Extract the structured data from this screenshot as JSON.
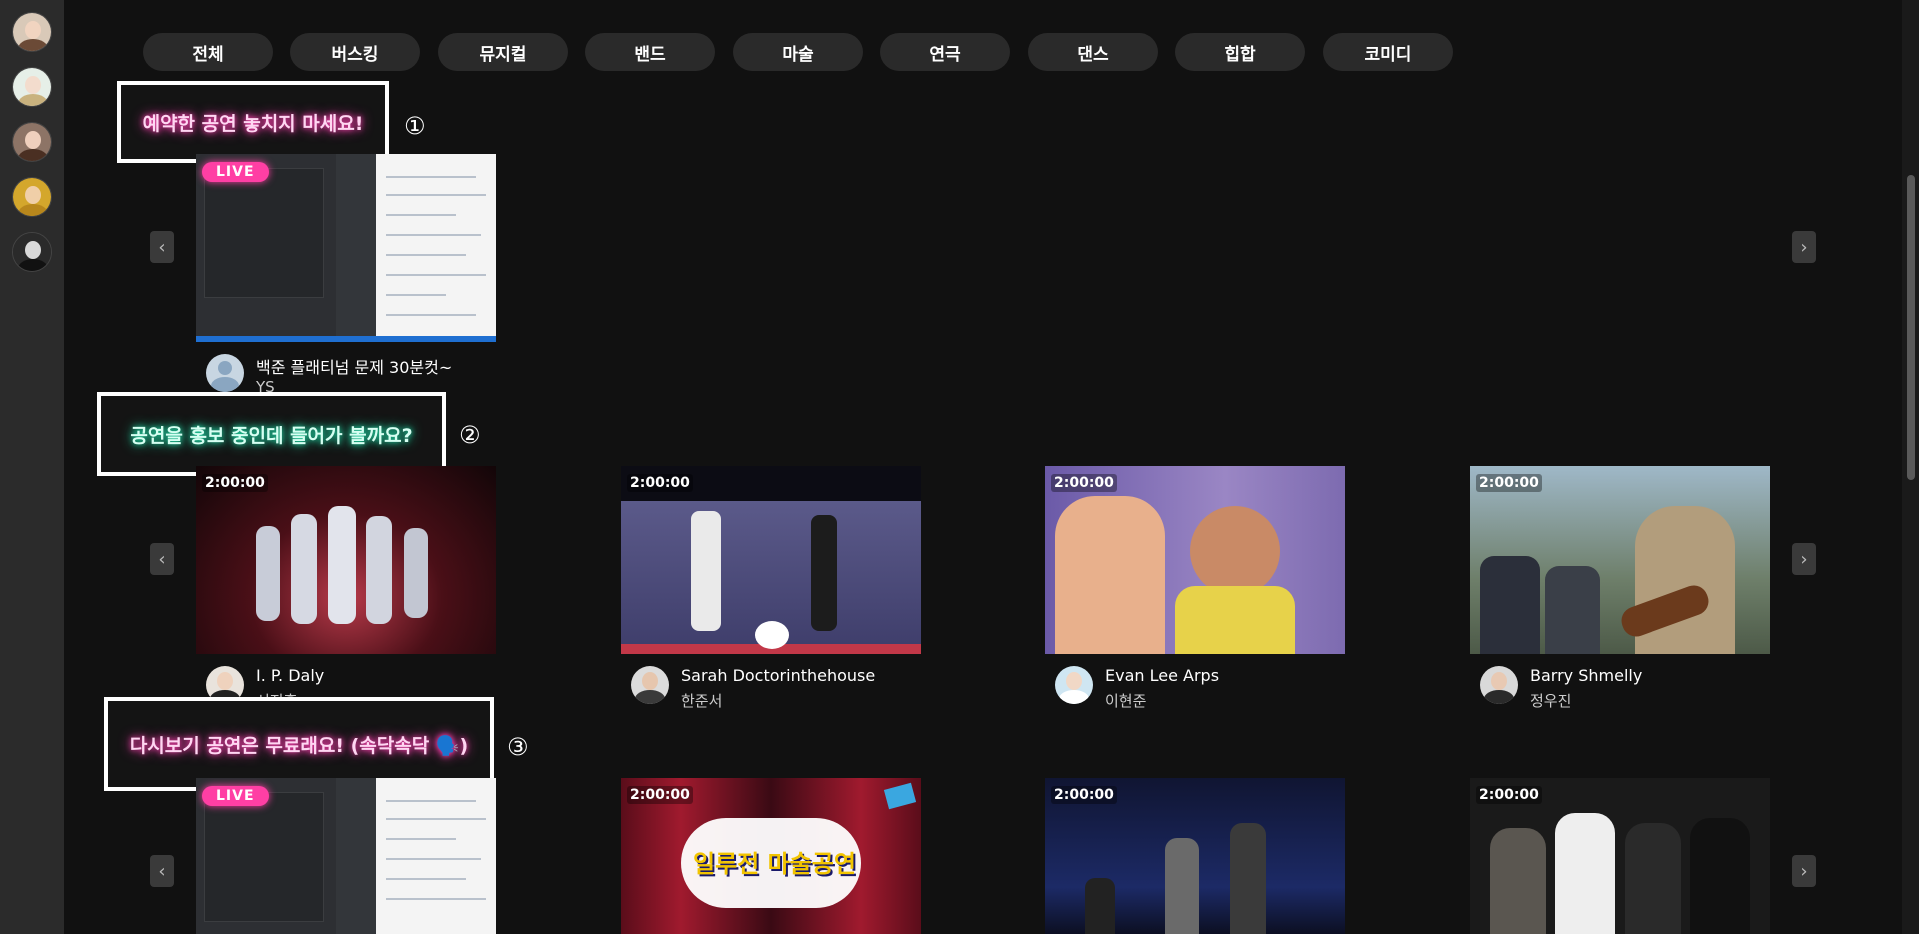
{
  "categories": [
    "전체",
    "버스킹",
    "뮤지컬",
    "밴드",
    "마술",
    "연극",
    "댄스",
    "힙합",
    "코미디"
  ],
  "sections": [
    {
      "label": "예약한 공연 놓치지 마세요!",
      "number": "①"
    },
    {
      "label": "공연을 홍보 중인데 들어가 볼까요?",
      "number": "②"
    },
    {
      "label": "다시보기 공연은 무료래요! (속닥속닥 🗣️)",
      "number": "③"
    }
  ],
  "arrows": {
    "prev": "‹",
    "next": "›"
  },
  "row1": [
    {
      "badge": "LIVE",
      "title": "백준 플래티넘 문제 30분컷~",
      "subtitle": "YS"
    }
  ],
  "row2": [
    {
      "duration": "2:00:00",
      "title": "I. P. Daly",
      "subtitle": "서지훈"
    },
    {
      "duration": "2:00:00",
      "title": "Sarah Doctorinthehouse",
      "subtitle": "한준서"
    },
    {
      "duration": "2:00:00",
      "title": "Evan Lee Arps",
      "subtitle": "이현준"
    },
    {
      "duration": "2:00:00",
      "title": "Barry Shmelly",
      "subtitle": "정우진"
    }
  ],
  "row3": [
    {
      "badge": "LIVE"
    },
    {
      "duration": "2:00:00",
      "poster_text": "일루전 마술공연"
    },
    {
      "duration": "2:00:00"
    },
    {
      "duration": "2:00:00"
    }
  ],
  "colors": {
    "live": "#ff3fa4",
    "pink_glow": "#ff3fb0",
    "teal_glow": "#1fd8a5"
  }
}
